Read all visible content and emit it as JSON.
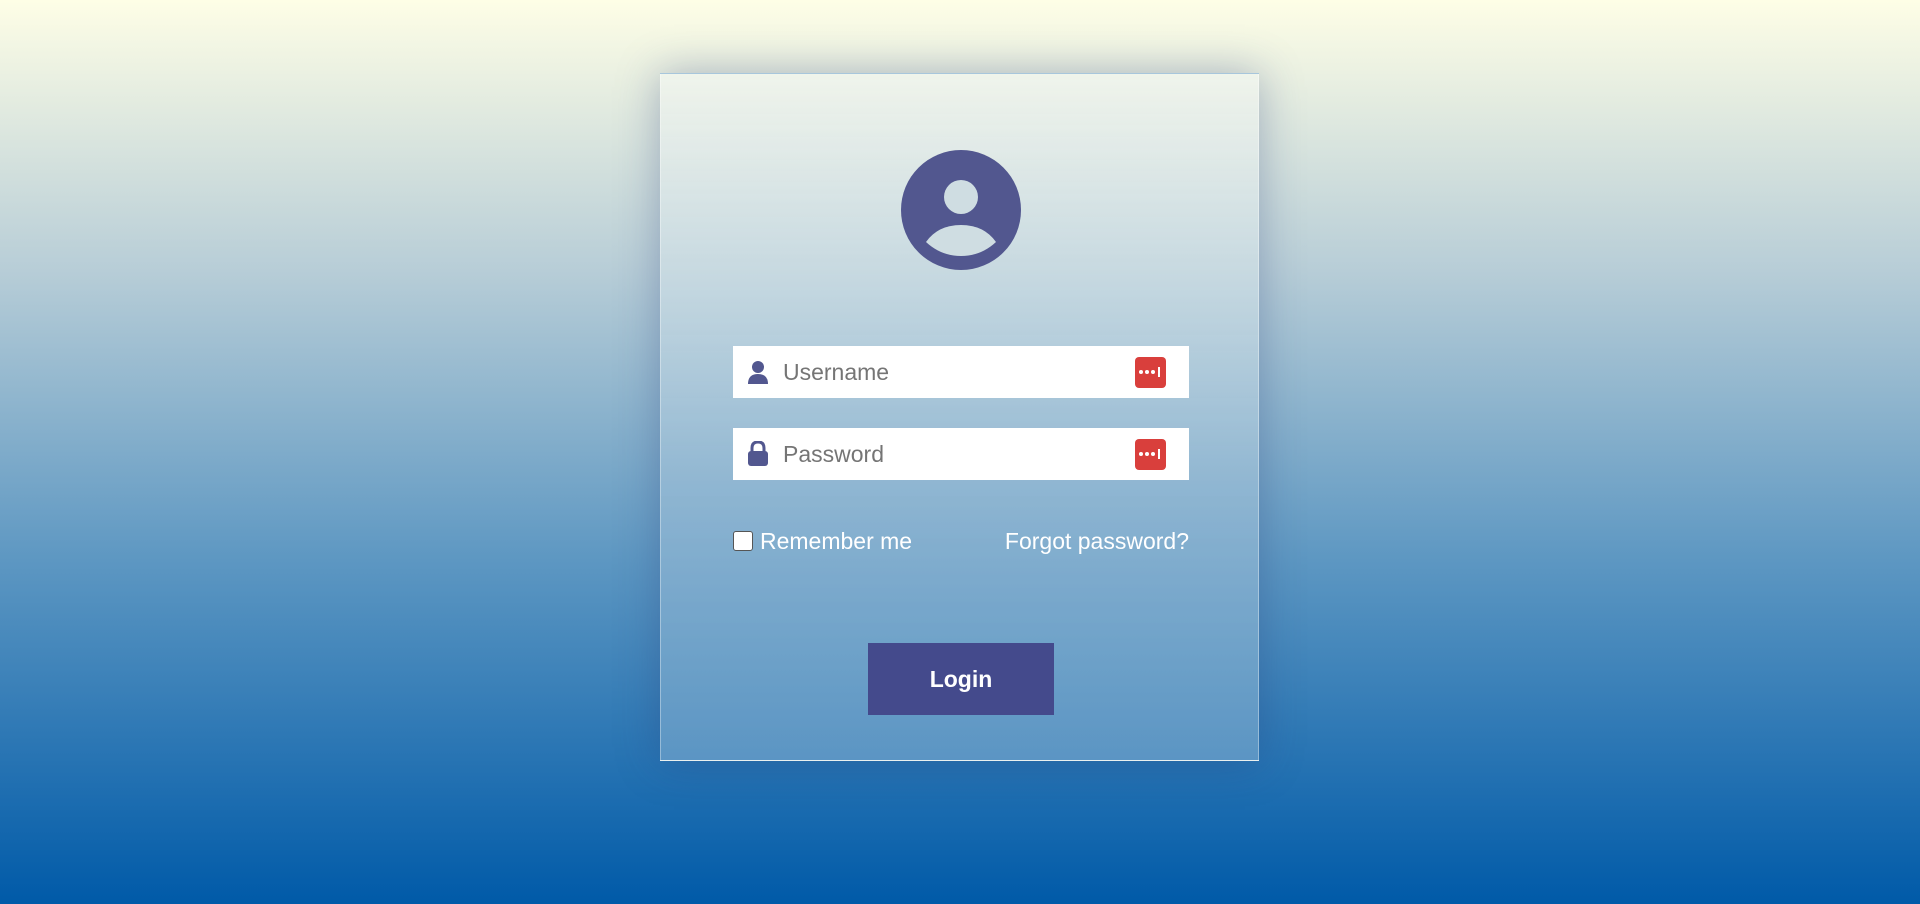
{
  "form": {
    "avatar_icon": "user-circle-icon",
    "username": {
      "placeholder": "Username",
      "value": "",
      "icon": "user-icon"
    },
    "password": {
      "placeholder": "Password",
      "value": "",
      "icon": "lock-icon"
    },
    "password_manager_icon": "password-manager-icon",
    "remember_label": "Remember me",
    "remember_checked": false,
    "forgot_label": "Forgot password?",
    "login_label": "Login"
  },
  "colors": {
    "accent": "#52578f",
    "button": "#444a8c",
    "password_manager": "#d93f3c"
  }
}
